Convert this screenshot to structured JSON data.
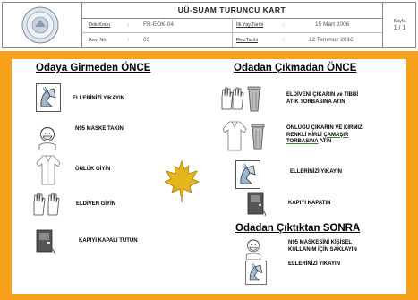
{
  "header": {
    "title": "UÜ-SUAM TURUNCU KART",
    "doc_code_label": "Dok.Kodu",
    "doc_code": "FR-EÖK-04",
    "rev_no_label": "Rev. No",
    "rev_no": "03",
    "pub_date_label": "İlk Yay.Tarihi",
    "pub_date": "15 Mart 2006",
    "rev_date_label": "Rev.Tarihi",
    "rev_date": "12 Temmuz 2016",
    "page_label": "Sayfa",
    "page_value": "1 / 1",
    "colon": ":"
  },
  "before_entry": {
    "heading": "Odaya Girmeden ÖNCE",
    "steps": [
      {
        "icon": "hand-washing-icon",
        "text": "ELLERİNİZİ YIKAYIN"
      },
      {
        "icon": "n95-mask-icon",
        "text": "N95 MASKE TAKIN"
      },
      {
        "icon": "gown-icon",
        "text": "ÖNLÜK GİYİN"
      },
      {
        "icon": "gloves-icon",
        "text": "ELDİVEN GİYİN"
      },
      {
        "icon": "door-icon",
        "text": "KAPIYI KAPALI TUTUN"
      }
    ]
  },
  "before_exit": {
    "heading": "Odadan Çıkmadan ÖNCE",
    "steps": [
      {
        "icon": "gloves-trash-icon",
        "line1": "ELDİVENİ ÇIKARIN ve TIBBİ",
        "line2": "ATIK TORBASINA  ATIN"
      },
      {
        "icon": "gown-trash-icon",
        "line1": "ÖNLÜĞÜ ÇIKARIN VE KIRMIZI",
        "line2": "RENKLİ KİRLİ ",
        "line2_underlined": "ÇAMAŞIR",
        "line3": "TORBASINA",
        "line3_rest": " ATIN"
      },
      {
        "icon": "hand-washing-icon",
        "text": "ELLERİNİZİ YIKAYIN"
      },
      {
        "icon": "door-icon",
        "text": "KAPIYI KAPATIN"
      }
    ]
  },
  "after_exit": {
    "heading": "Odadan Çıktıktan SONRA",
    "steps": [
      {
        "icon": "n95-mask-icon",
        "line1": "N95 MASKESİNİ  KİŞİSEL",
        "line2": "KULLANIM İÇİN SAKLAYIN"
      },
      {
        "icon": "hand-washing-icon",
        "text": "ELLERİNİZİ YIKAYIN"
      }
    ]
  },
  "colors": {
    "frame": "#f7a11a",
    "leaf": "#e6b51c",
    "underline_accent": "#2a8a2a"
  }
}
